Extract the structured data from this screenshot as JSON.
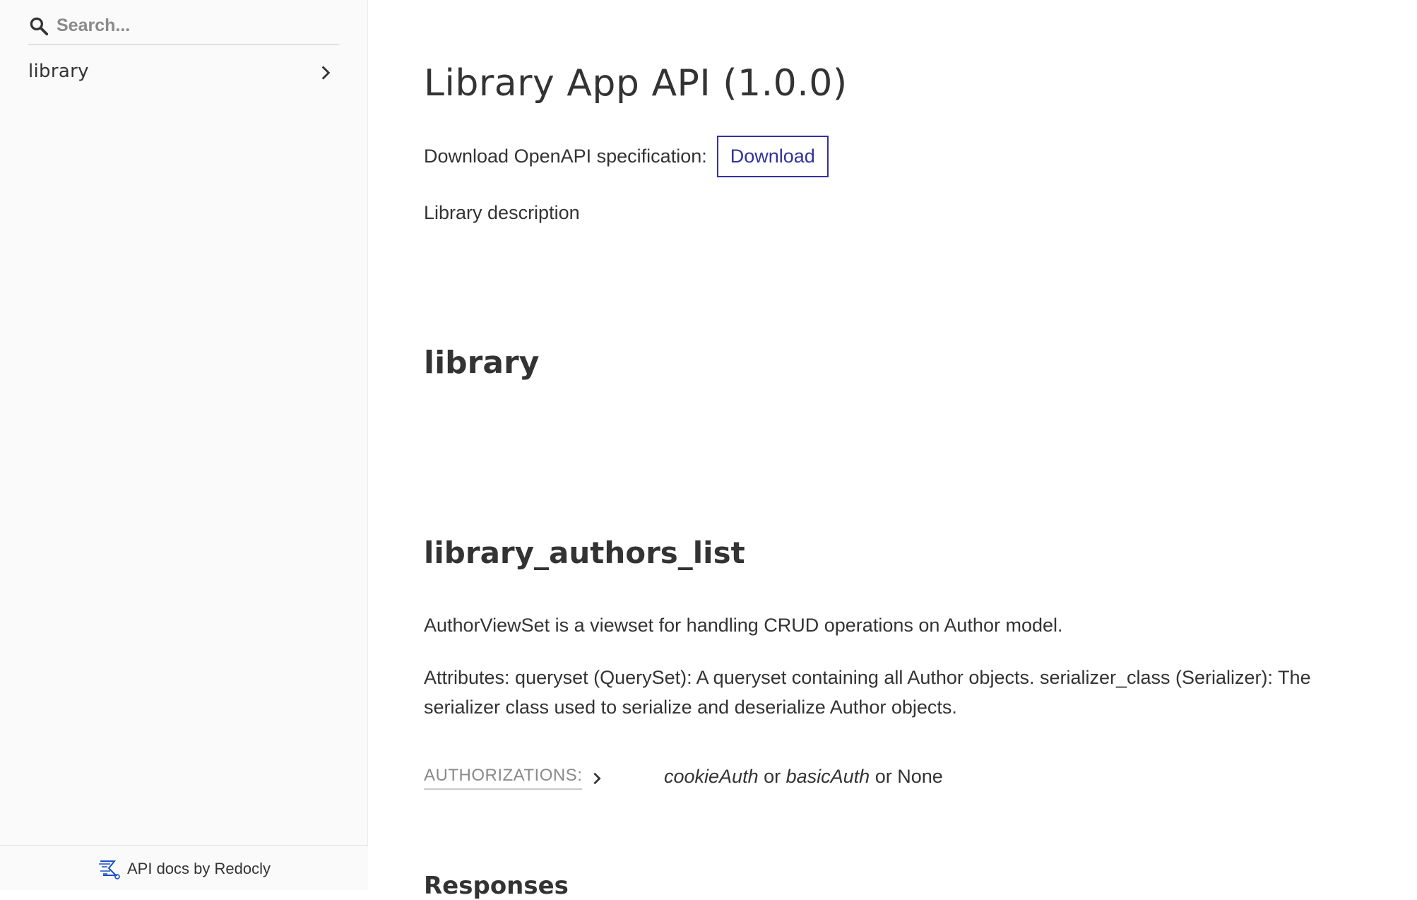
{
  "sidebar": {
    "search": {
      "placeholder": "Search...",
      "value": ""
    },
    "items": [
      {
        "label": "library",
        "icon": "chevron-right-icon"
      }
    ],
    "footer": {
      "text": "API docs by Redocly",
      "icon": "redocly-logo-icon"
    }
  },
  "main": {
    "title": "Library App API (1.0.0)",
    "download_label": "Download OpenAPI specification:",
    "download_button": "Download",
    "description": "Library description",
    "section_title": "library",
    "operation": {
      "title": "library_authors_list",
      "description_1": "AuthorViewSet is a viewset for handling CRUD operations on Author model.",
      "description_2": "Attributes: queryset (QuerySet): A queryset containing all Author objects. serializer_class (Serializer): The serializer class used to serialize and deserialize Author objects.",
      "authorizations_label": "AUTHORIZATIONS:",
      "auth_1": "cookieAuth",
      "auth_or_1": " or ",
      "auth_2": "basicAuth",
      "auth_or_2": " or None",
      "responses_title": "Responses"
    }
  },
  "colors": {
    "accent": "#32329f",
    "sidebar_bg": "#fafafa",
    "muted": "#8a8a8a"
  }
}
